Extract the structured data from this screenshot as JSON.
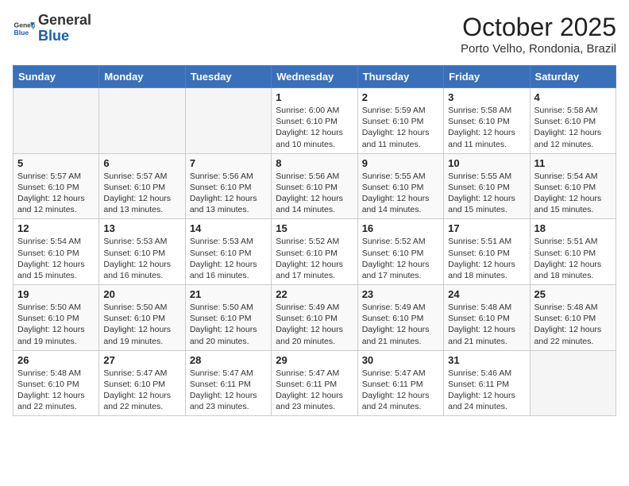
{
  "header": {
    "logo_general": "General",
    "logo_blue": "Blue",
    "month_title": "October 2025",
    "location": "Porto Velho, Rondonia, Brazil"
  },
  "days_of_week": [
    "Sunday",
    "Monday",
    "Tuesday",
    "Wednesday",
    "Thursday",
    "Friday",
    "Saturday"
  ],
  "weeks": [
    [
      {
        "day": "",
        "info": ""
      },
      {
        "day": "",
        "info": ""
      },
      {
        "day": "",
        "info": ""
      },
      {
        "day": "1",
        "info": "Sunrise: 6:00 AM\nSunset: 6:10 PM\nDaylight: 12 hours\nand 10 minutes."
      },
      {
        "day": "2",
        "info": "Sunrise: 5:59 AM\nSunset: 6:10 PM\nDaylight: 12 hours\nand 11 minutes."
      },
      {
        "day": "3",
        "info": "Sunrise: 5:58 AM\nSunset: 6:10 PM\nDaylight: 12 hours\nand 11 minutes."
      },
      {
        "day": "4",
        "info": "Sunrise: 5:58 AM\nSunset: 6:10 PM\nDaylight: 12 hours\nand 12 minutes."
      }
    ],
    [
      {
        "day": "5",
        "info": "Sunrise: 5:57 AM\nSunset: 6:10 PM\nDaylight: 12 hours\nand 12 minutes."
      },
      {
        "day": "6",
        "info": "Sunrise: 5:57 AM\nSunset: 6:10 PM\nDaylight: 12 hours\nand 13 minutes."
      },
      {
        "day": "7",
        "info": "Sunrise: 5:56 AM\nSunset: 6:10 PM\nDaylight: 12 hours\nand 13 minutes."
      },
      {
        "day": "8",
        "info": "Sunrise: 5:56 AM\nSunset: 6:10 PM\nDaylight: 12 hours\nand 14 minutes."
      },
      {
        "day": "9",
        "info": "Sunrise: 5:55 AM\nSunset: 6:10 PM\nDaylight: 12 hours\nand 14 minutes."
      },
      {
        "day": "10",
        "info": "Sunrise: 5:55 AM\nSunset: 6:10 PM\nDaylight: 12 hours\nand 15 minutes."
      },
      {
        "day": "11",
        "info": "Sunrise: 5:54 AM\nSunset: 6:10 PM\nDaylight: 12 hours\nand 15 minutes."
      }
    ],
    [
      {
        "day": "12",
        "info": "Sunrise: 5:54 AM\nSunset: 6:10 PM\nDaylight: 12 hours\nand 15 minutes."
      },
      {
        "day": "13",
        "info": "Sunrise: 5:53 AM\nSunset: 6:10 PM\nDaylight: 12 hours\nand 16 minutes."
      },
      {
        "day": "14",
        "info": "Sunrise: 5:53 AM\nSunset: 6:10 PM\nDaylight: 12 hours\nand 16 minutes."
      },
      {
        "day": "15",
        "info": "Sunrise: 5:52 AM\nSunset: 6:10 PM\nDaylight: 12 hours\nand 17 minutes."
      },
      {
        "day": "16",
        "info": "Sunrise: 5:52 AM\nSunset: 6:10 PM\nDaylight: 12 hours\nand 17 minutes."
      },
      {
        "day": "17",
        "info": "Sunrise: 5:51 AM\nSunset: 6:10 PM\nDaylight: 12 hours\nand 18 minutes."
      },
      {
        "day": "18",
        "info": "Sunrise: 5:51 AM\nSunset: 6:10 PM\nDaylight: 12 hours\nand 18 minutes."
      }
    ],
    [
      {
        "day": "19",
        "info": "Sunrise: 5:50 AM\nSunset: 6:10 PM\nDaylight: 12 hours\nand 19 minutes."
      },
      {
        "day": "20",
        "info": "Sunrise: 5:50 AM\nSunset: 6:10 PM\nDaylight: 12 hours\nand 19 minutes."
      },
      {
        "day": "21",
        "info": "Sunrise: 5:50 AM\nSunset: 6:10 PM\nDaylight: 12 hours\nand 20 minutes."
      },
      {
        "day": "22",
        "info": "Sunrise: 5:49 AM\nSunset: 6:10 PM\nDaylight: 12 hours\nand 20 minutes."
      },
      {
        "day": "23",
        "info": "Sunrise: 5:49 AM\nSunset: 6:10 PM\nDaylight: 12 hours\nand 21 minutes."
      },
      {
        "day": "24",
        "info": "Sunrise: 5:48 AM\nSunset: 6:10 PM\nDaylight: 12 hours\nand 21 minutes."
      },
      {
        "day": "25",
        "info": "Sunrise: 5:48 AM\nSunset: 6:10 PM\nDaylight: 12 hours\nand 22 minutes."
      }
    ],
    [
      {
        "day": "26",
        "info": "Sunrise: 5:48 AM\nSunset: 6:10 PM\nDaylight: 12 hours\nand 22 minutes."
      },
      {
        "day": "27",
        "info": "Sunrise: 5:47 AM\nSunset: 6:10 PM\nDaylight: 12 hours\nand 22 minutes."
      },
      {
        "day": "28",
        "info": "Sunrise: 5:47 AM\nSunset: 6:11 PM\nDaylight: 12 hours\nand 23 minutes."
      },
      {
        "day": "29",
        "info": "Sunrise: 5:47 AM\nSunset: 6:11 PM\nDaylight: 12 hours\nand 23 minutes."
      },
      {
        "day": "30",
        "info": "Sunrise: 5:47 AM\nSunset: 6:11 PM\nDaylight: 12 hours\nand 24 minutes."
      },
      {
        "day": "31",
        "info": "Sunrise: 5:46 AM\nSunset: 6:11 PM\nDaylight: 12 hours\nand 24 minutes."
      },
      {
        "day": "",
        "info": ""
      }
    ]
  ]
}
